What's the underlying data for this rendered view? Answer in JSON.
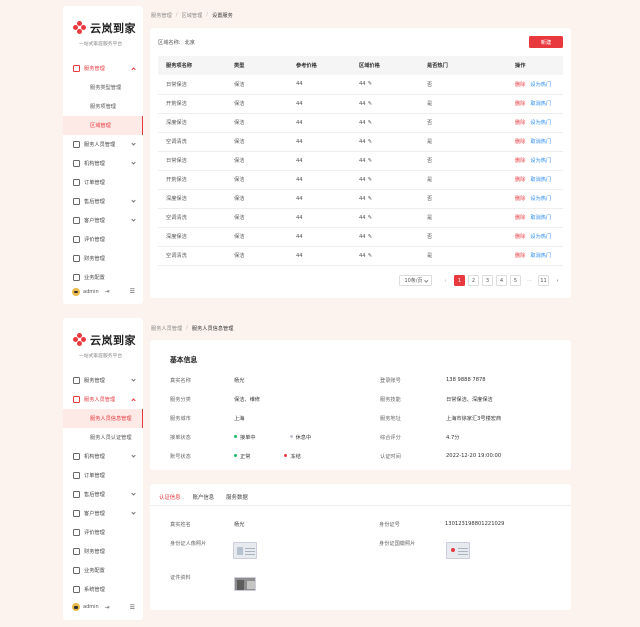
{
  "brand": {
    "name": "云岚到家",
    "slogan": "一站式家庭服务平台"
  },
  "footer": {
    "user": "admin"
  },
  "screen1": {
    "sidebar": [
      {
        "label": "服务管理",
        "open": true,
        "chev": true
      },
      {
        "label": "服务类型管理",
        "sub": true
      },
      {
        "label": "服务项管理",
        "sub": true
      },
      {
        "label": "区域管理",
        "sub": true,
        "active": true
      },
      {
        "label": "服务人员管理",
        "chev": true
      },
      {
        "label": "机构管理",
        "chev": true
      },
      {
        "label": "订单管理"
      },
      {
        "label": "售后管理",
        "chev": true
      },
      {
        "label": "客户管理",
        "chev": true
      },
      {
        "label": "评价管理"
      },
      {
        "label": "财务管理"
      },
      {
        "label": "业务配置"
      }
    ],
    "breadcrumb": [
      "服务管理",
      "区域管理",
      "设置服务"
    ],
    "filter": {
      "label": "区域名称:",
      "value": "北京",
      "new_button": "新建"
    },
    "table": {
      "columns": [
        "服务项名称",
        "类型",
        "参考价格",
        "区域价格",
        "是否热门",
        "操作"
      ],
      "rows": [
        {
          "name": "日常保洁",
          "type": "保洁",
          "ref": "44",
          "area": "44",
          "hot": "否",
          "del": "删除",
          "hot_action": "设为热门"
        },
        {
          "name": "开荒保洁",
          "type": "保洁",
          "ref": "44",
          "area": "44",
          "hot": "是",
          "del": "删除",
          "hot_action": "取消热门"
        },
        {
          "name": "深度保洁",
          "type": "保洁",
          "ref": "44",
          "area": "44",
          "hot": "否",
          "del": "删除",
          "hot_action": "设为热门"
        },
        {
          "name": "空调清洗",
          "type": "保洁",
          "ref": "44",
          "area": "44",
          "hot": "是",
          "del": "删除",
          "hot_action": "取消热门"
        },
        {
          "name": "日常保洁",
          "type": "保洁",
          "ref": "44",
          "area": "44",
          "hot": "否",
          "del": "删除",
          "hot_action": "设为热门"
        },
        {
          "name": "开荒保洁",
          "type": "保洁",
          "ref": "44",
          "area": "44",
          "hot": "是",
          "del": "删除",
          "hot_action": "取消热门"
        },
        {
          "name": "深度保洁",
          "type": "保洁",
          "ref": "44",
          "area": "44",
          "hot": "否",
          "del": "删除",
          "hot_action": "设为热门"
        },
        {
          "name": "空调清洗",
          "type": "保洁",
          "ref": "44",
          "area": "44",
          "hot": "是",
          "del": "删除",
          "hot_action": "取消热门"
        },
        {
          "name": "深度保洁",
          "type": "保洁",
          "ref": "44",
          "area": "44",
          "hot": "否",
          "del": "删除",
          "hot_action": "设为热门"
        },
        {
          "name": "空调清洗",
          "type": "保洁",
          "ref": "44",
          "area": "44",
          "hot": "是",
          "del": "删除",
          "hot_action": "取消热门"
        }
      ]
    },
    "pagination": {
      "page_size": "10条/页",
      "pages": [
        "1",
        "2",
        "3",
        "4",
        "5",
        "···",
        "11"
      ],
      "current": "1"
    }
  },
  "screen2": {
    "sidebar": [
      {
        "label": "服务管理",
        "chev": true
      },
      {
        "label": "服务人员管理",
        "open": true,
        "chev": true
      },
      {
        "label": "服务人员信息管理",
        "sub": true,
        "active": true
      },
      {
        "label": "服务人员认证管理",
        "sub": true
      },
      {
        "label": "机构管理",
        "chev": true
      },
      {
        "label": "订单管理"
      },
      {
        "label": "售后管理",
        "chev": true
      },
      {
        "label": "客户管理",
        "chev": true
      },
      {
        "label": "评价管理"
      },
      {
        "label": "财务管理"
      },
      {
        "label": "业务配置"
      },
      {
        "label": "系统管理"
      }
    ],
    "breadcrumb": [
      "服务人员管理",
      "服务人员信息管理"
    ],
    "basic": {
      "title": "基本信息",
      "fields": [
        {
          "k": "真实名称",
          "v": "杨光"
        },
        {
          "k": "登录账号",
          "v": "138 9888 7878"
        },
        {
          "k": "服务分类",
          "v": "保洁、维修"
        },
        {
          "k": "服务技能",
          "v": "日常保洁、深度保洁"
        },
        {
          "k": "服务城市",
          "v": "上海"
        },
        {
          "k": "服务地址",
          "v": "上海市徐家汇3号楼宏商"
        },
        {
          "k": "接单状态",
          "v": "接单中",
          "v2": "休息中"
        },
        {
          "k": "综合评分",
          "v": "4.7分"
        },
        {
          "k": "账号状态",
          "v": "正常",
          "v2": "冻结"
        },
        {
          "k": "认证时间",
          "v": "2022-12-20 19:00:00"
        }
      ],
      "colors": {
        "green": "#19be6b",
        "grey": "#c0c4cc",
        "red": "#e8393f"
      }
    },
    "tabs": [
      "认证信息",
      "账户信息",
      "服务数据"
    ],
    "auth": {
      "name_label": "真实姓名",
      "name": "杨光",
      "id_label": "身份证号",
      "id": "130123198801221029",
      "front_label": "身份证人像照片",
      "back_label": "身份证国徽照片",
      "cert_label": "证件资料"
    }
  },
  "colors": {
    "accent": "#e8393f",
    "link": "#2d8cf0",
    "bg": "#fdf3ee"
  }
}
